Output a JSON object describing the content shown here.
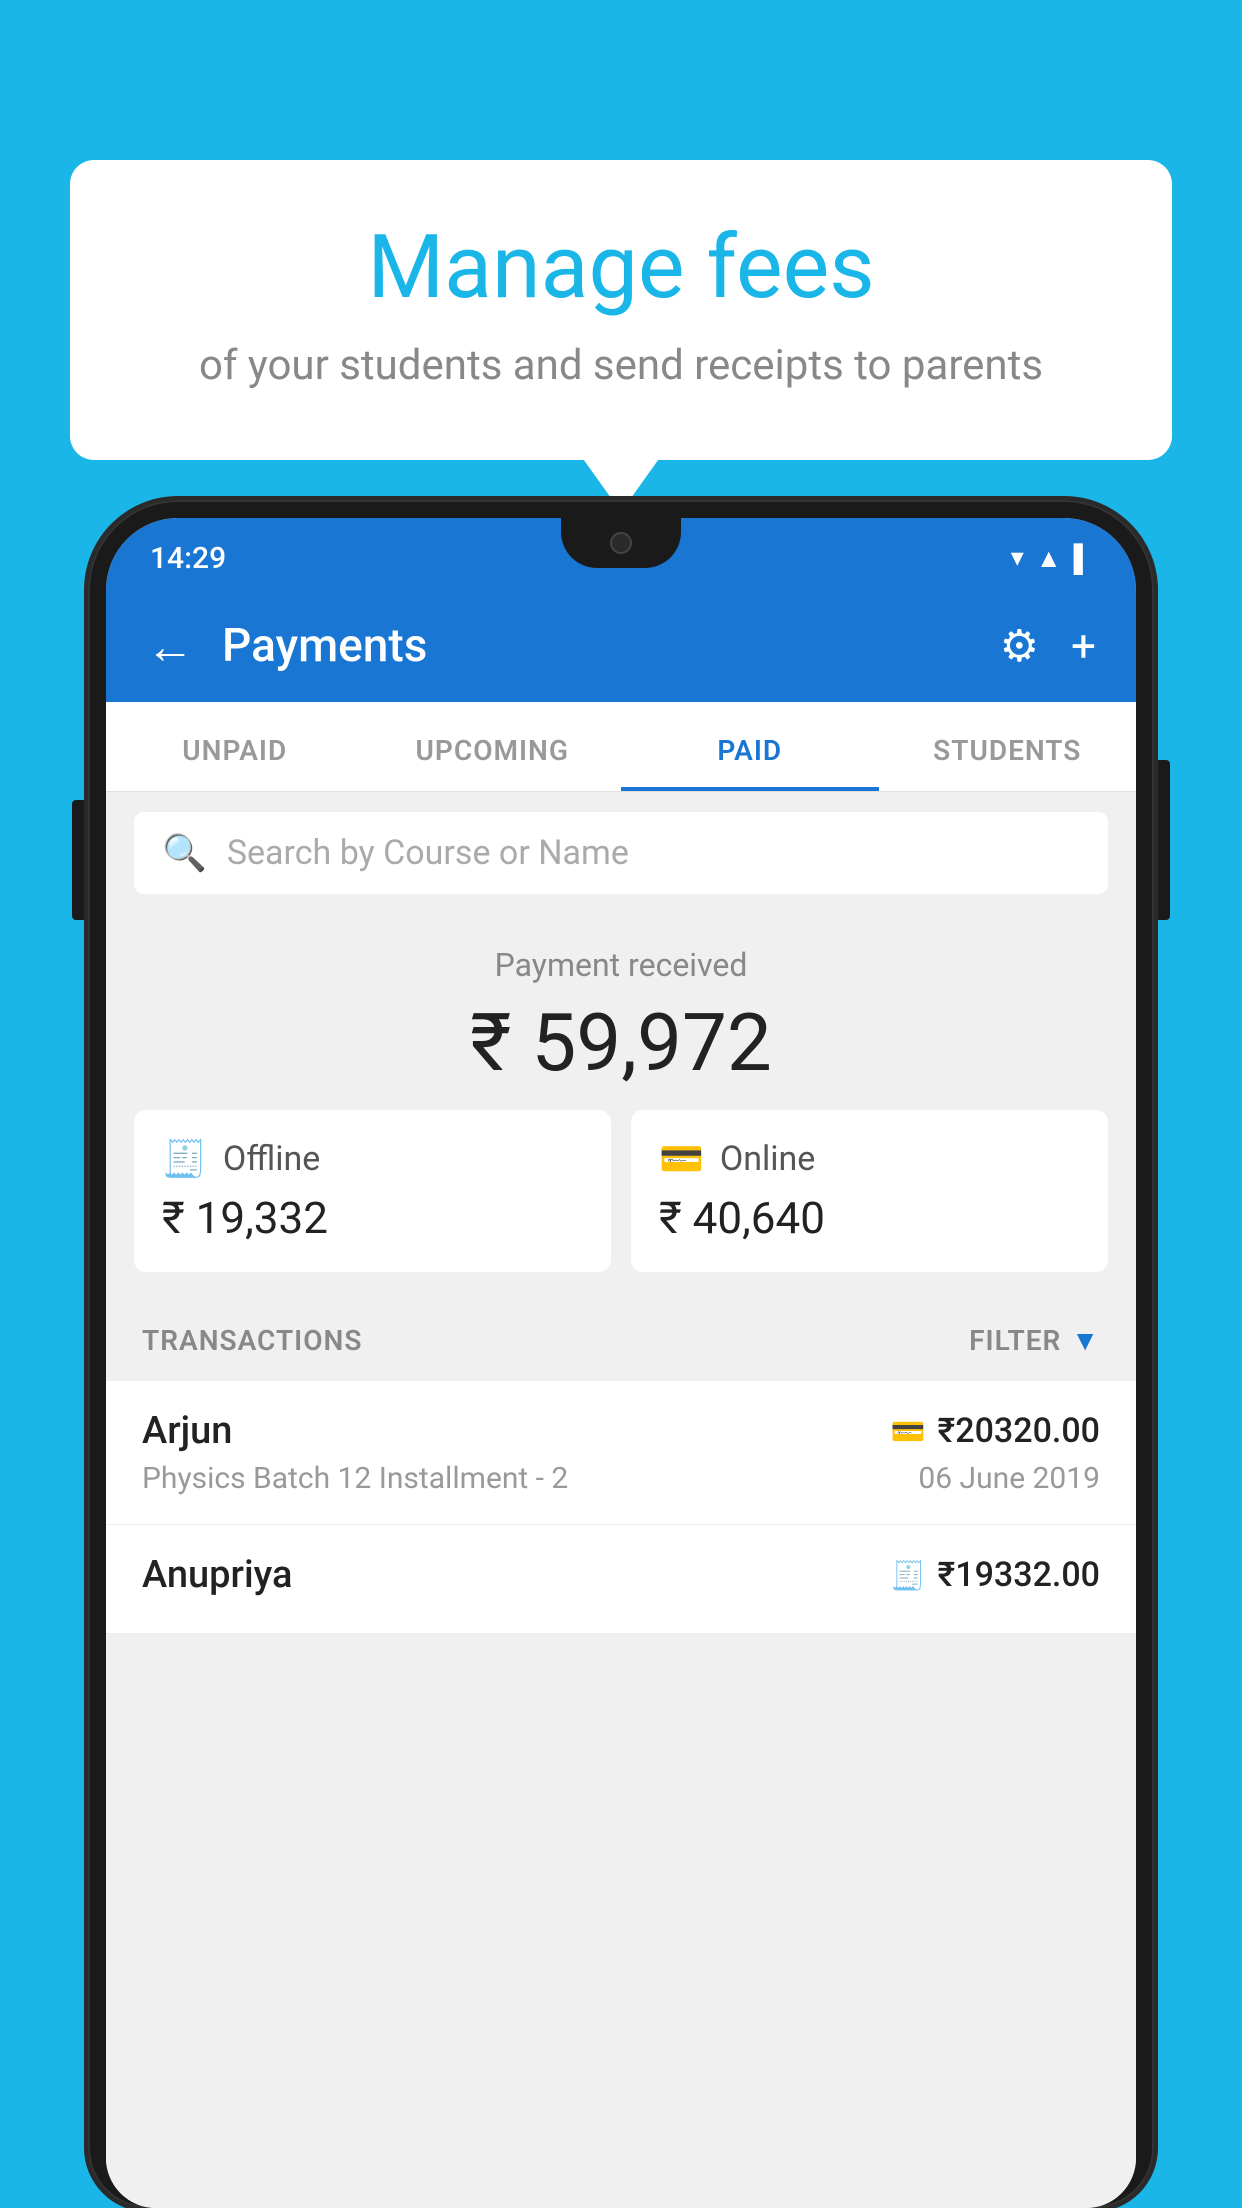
{
  "background_color": "#1ab6e8",
  "bubble": {
    "title": "Manage fees",
    "subtitle": "of your students and send receipts to parents"
  },
  "status_bar": {
    "time": "14:29",
    "icons": [
      "wifi",
      "signal",
      "battery"
    ]
  },
  "app_bar": {
    "title": "Payments",
    "back_label": "←",
    "gear_label": "⚙",
    "plus_label": "+"
  },
  "tabs": [
    {
      "label": "UNPAID",
      "active": false
    },
    {
      "label": "UPCOMING",
      "active": false
    },
    {
      "label": "PAID",
      "active": true
    },
    {
      "label": "STUDENTS",
      "active": false
    }
  ],
  "search": {
    "placeholder": "Search by Course or Name"
  },
  "payment_summary": {
    "label": "Payment received",
    "amount": "₹ 59,972",
    "offline_label": "Offline",
    "offline_amount": "₹ 19,332",
    "online_label": "Online",
    "online_amount": "₹ 40,640"
  },
  "transactions_section": {
    "label": "TRANSACTIONS",
    "filter_label": "FILTER"
  },
  "transactions": [
    {
      "name": "Arjun",
      "course": "Physics Batch 12 Installment - 2",
      "amount": "₹20320.00",
      "date": "06 June 2019",
      "payment_type": "card"
    },
    {
      "name": "Anupriya",
      "course": "",
      "amount": "₹19332.00",
      "date": "",
      "payment_type": "offline"
    }
  ]
}
